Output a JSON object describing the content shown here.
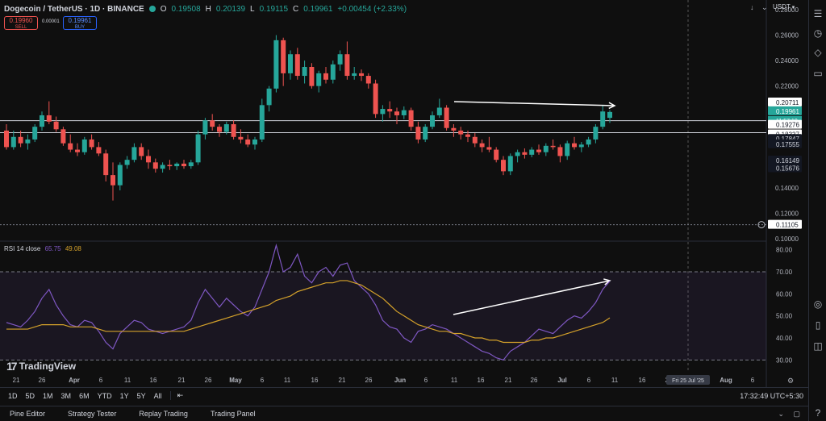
{
  "header": {
    "symbol": "Dogecoin / TetherUS · 1D · BINANCE",
    "o_label": "O",
    "o": "0.19508",
    "h_label": "H",
    "h": "0.20139",
    "l_label": "L",
    "l": "0.19115",
    "c_label": "C",
    "c": "0.19961",
    "change": "+0.00454 (+2.33%)",
    "currency": "USDT"
  },
  "trade": {
    "sell_price": "0.19960",
    "sell_label": "SELL",
    "buy_price": "0.19961",
    "buy_label": "BUY",
    "spread": "0.00001"
  },
  "price_axis": {
    "ticks": [
      "0.28000",
      "0.26000",
      "0.24000",
      "0.22000",
      "0.14000",
      "0.12000",
      "0.10000"
    ],
    "tags": {
      "t1": "0.20711",
      "current": "0.19961",
      "countdown": "11:57:10",
      "t3": "0.19276",
      "t4": "0.18337",
      "t5": "0.17847",
      "t6": "0.17555",
      "t7": "0.16149",
      "t8": "0.15676",
      "low": "0.11105"
    }
  },
  "rsi": {
    "label": "RSI 14 close",
    "value1": "65.75",
    "value2": "49.08",
    "ticks": [
      "80.00",
      "70.00",
      "60.00",
      "50.00",
      "40.00",
      "30.00"
    ]
  },
  "time_axis": {
    "labels": [
      "21",
      "26",
      "Apr",
      "6",
      "11",
      "16",
      "21",
      "26",
      "May",
      "6",
      "11",
      "16",
      "21",
      "26",
      "Jun",
      "6",
      "11",
      "16",
      "21",
      "26",
      "Jul",
      "6",
      "11",
      "16",
      "21",
      "Aug",
      "6"
    ],
    "crosshair_date": "Fri 25 Jul '25"
  },
  "timeframes": [
    "1D",
    "5D",
    "1M",
    "3M",
    "6M",
    "YTD",
    "1Y",
    "5Y",
    "All"
  ],
  "clock": "17:32:49 UTC+5:30",
  "footer_tabs": [
    "Pine Editor",
    "Strategy Tester",
    "Replay Trading",
    "Trading Panel"
  ],
  "logo_text": "TradingView",
  "colors": {
    "up": "#26a69a",
    "down": "#ef5350",
    "rsi": "#7e57c2",
    "rsi_ma": "#d4a12a"
  },
  "chart_data": {
    "type": "candlestick",
    "symbol": "DOGEUSDT",
    "interval": "1D",
    "ylim": [
      0.1,
      0.28
    ],
    "candles": [
      [
        0.185,
        0.19,
        0.17,
        0.172
      ],
      [
        0.172,
        0.185,
        0.17,
        0.18
      ],
      [
        0.18,
        0.185,
        0.172,
        0.175
      ],
      [
        0.175,
        0.182,
        0.17,
        0.178
      ],
      [
        0.178,
        0.19,
        0.176,
        0.188
      ],
      [
        0.188,
        0.2,
        0.185,
        0.197
      ],
      [
        0.197,
        0.208,
        0.19,
        0.192
      ],
      [
        0.192,
        0.196,
        0.184,
        0.186
      ],
      [
        0.186,
        0.188,
        0.173,
        0.175
      ],
      [
        0.175,
        0.182,
        0.168,
        0.17
      ],
      [
        0.17,
        0.175,
        0.165,
        0.168
      ],
      [
        0.168,
        0.18,
        0.166,
        0.178
      ],
      [
        0.178,
        0.182,
        0.17,
        0.172
      ],
      [
        0.172,
        0.176,
        0.165,
        0.167
      ],
      [
        0.167,
        0.17,
        0.145,
        0.15
      ],
      [
        0.15,
        0.16,
        0.13,
        0.142
      ],
      [
        0.142,
        0.16,
        0.138,
        0.158
      ],
      [
        0.158,
        0.165,
        0.155,
        0.162
      ],
      [
        0.162,
        0.175,
        0.16,
        0.172
      ],
      [
        0.172,
        0.175,
        0.162,
        0.165
      ],
      [
        0.165,
        0.17,
        0.155,
        0.16
      ],
      [
        0.16,
        0.163,
        0.152,
        0.155
      ],
      [
        0.155,
        0.16,
        0.152,
        0.158
      ],
      [
        0.158,
        0.162,
        0.154,
        0.157
      ],
      [
        0.157,
        0.16,
        0.154,
        0.159
      ],
      [
        0.159,
        0.162,
        0.155,
        0.157
      ],
      [
        0.157,
        0.162,
        0.155,
        0.16
      ],
      [
        0.16,
        0.185,
        0.158,
        0.182
      ],
      [
        0.182,
        0.195,
        0.178,
        0.193
      ],
      [
        0.193,
        0.198,
        0.185,
        0.188
      ],
      [
        0.188,
        0.19,
        0.18,
        0.184
      ],
      [
        0.184,
        0.192,
        0.182,
        0.19
      ],
      [
        0.19,
        0.193,
        0.178,
        0.18
      ],
      [
        0.18,
        0.186,
        0.175,
        0.178
      ],
      [
        0.178,
        0.182,
        0.172,
        0.174
      ],
      [
        0.174,
        0.18,
        0.17,
        0.178
      ],
      [
        0.178,
        0.21,
        0.176,
        0.205
      ],
      [
        0.205,
        0.22,
        0.2,
        0.218
      ],
      [
        0.218,
        0.26,
        0.215,
        0.256
      ],
      [
        0.256,
        0.258,
        0.22,
        0.23
      ],
      [
        0.23,
        0.248,
        0.225,
        0.245
      ],
      [
        0.245,
        0.25,
        0.225,
        0.228
      ],
      [
        0.228,
        0.24,
        0.222,
        0.235
      ],
      [
        0.235,
        0.238,
        0.218,
        0.22
      ],
      [
        0.22,
        0.232,
        0.215,
        0.23
      ],
      [
        0.23,
        0.235,
        0.222,
        0.225
      ],
      [
        0.225,
        0.24,
        0.222,
        0.237
      ],
      [
        0.237,
        0.248,
        0.232,
        0.245
      ],
      [
        0.245,
        0.255,
        0.225,
        0.228
      ],
      [
        0.228,
        0.235,
        0.225,
        0.23
      ],
      [
        0.23,
        0.233,
        0.224,
        0.228
      ],
      [
        0.228,
        0.23,
        0.218,
        0.222
      ],
      [
        0.222,
        0.225,
        0.195,
        0.198
      ],
      [
        0.198,
        0.205,
        0.192,
        0.202
      ],
      [
        0.202,
        0.208,
        0.195,
        0.2
      ],
      [
        0.2,
        0.203,
        0.19,
        0.197
      ],
      [
        0.197,
        0.204,
        0.194,
        0.201
      ],
      [
        0.201,
        0.203,
        0.185,
        0.188
      ],
      [
        0.188,
        0.192,
        0.175,
        0.178
      ],
      [
        0.178,
        0.19,
        0.176,
        0.188
      ],
      [
        0.188,
        0.2,
        0.186,
        0.197
      ],
      [
        0.197,
        0.21,
        0.195,
        0.203
      ],
      [
        0.203,
        0.205,
        0.185,
        0.187
      ],
      [
        0.187,
        0.19,
        0.18,
        0.185
      ],
      [
        0.185,
        0.188,
        0.178,
        0.182
      ],
      [
        0.182,
        0.185,
        0.176,
        0.18
      ],
      [
        0.18,
        0.183,
        0.172,
        0.175
      ],
      [
        0.175,
        0.178,
        0.168,
        0.172
      ],
      [
        0.172,
        0.18,
        0.168,
        0.17
      ],
      [
        0.17,
        0.172,
        0.16,
        0.162
      ],
      [
        0.162,
        0.165,
        0.15,
        0.153
      ],
      [
        0.153,
        0.167,
        0.15,
        0.165
      ],
      [
        0.165,
        0.17,
        0.16,
        0.168
      ],
      [
        0.168,
        0.171,
        0.163,
        0.166
      ],
      [
        0.166,
        0.172,
        0.164,
        0.17
      ],
      [
        0.17,
        0.174,
        0.166,
        0.168
      ],
      [
        0.168,
        0.175,
        0.165,
        0.173
      ],
      [
        0.173,
        0.178,
        0.17,
        0.172
      ],
      [
        0.172,
        0.174,
        0.16,
        0.165
      ],
      [
        0.165,
        0.177,
        0.162,
        0.175
      ],
      [
        0.175,
        0.18,
        0.17,
        0.172
      ],
      [
        0.172,
        0.176,
        0.168,
        0.174
      ],
      [
        0.174,
        0.18,
        0.172,
        0.178
      ],
      [
        0.178,
        0.19,
        0.175,
        0.188
      ],
      [
        0.188,
        0.205,
        0.186,
        0.2
      ],
      [
        0.195,
        0.201,
        0.191,
        0.1996
      ]
    ],
    "horizontal_levels": [
      0.20711,
      0.19276,
      0.18337,
      0.11105
    ],
    "rsi_series": [
      47,
      46,
      45,
      48,
      52,
      58,
      62,
      55,
      50,
      46,
      45,
      48,
      47,
      43,
      38,
      35,
      42,
      45,
      48,
      47,
      44,
      43,
      42,
      43,
      44,
      45,
      48,
      56,
      62,
      58,
      54,
      58,
      55,
      52,
      50,
      54,
      62,
      70,
      82,
      70,
      72,
      78,
      68,
      65,
      70,
      72,
      68,
      73,
      74,
      66,
      63,
      60,
      55,
      48,
      45,
      44,
      40,
      38,
      43,
      44,
      46,
      45,
      44,
      42,
      40,
      38,
      36,
      34,
      33,
      31,
      30,
      34,
      36,
      38,
      41,
      44,
      43,
      42,
      45,
      48,
      50,
      49,
      52,
      56,
      62,
      65.75
    ],
    "rsi_ma_series": [
      44,
      44,
      44,
      44,
      45,
      46,
      46,
      46,
      46,
      45,
      45,
      45,
      45,
      44,
      43,
      43,
      43,
      43,
      43,
      43,
      43,
      43,
      43,
      43,
      43,
      43,
      44,
      45,
      46,
      47,
      48,
      49,
      50,
      51,
      52,
      53,
      54,
      55,
      57,
      58,
      59,
      61,
      62,
      63,
      64,
      65,
      65,
      66,
      66,
      65,
      64,
      62,
      60,
      58,
      55,
      52,
      50,
      48,
      46,
      45,
      44,
      43,
      43,
      42,
      42,
      41,
      40,
      40,
      39,
      39,
      38,
      38,
      38,
      38,
      39,
      39,
      40,
      40,
      41,
      42,
      43,
      44,
      45,
      46,
      47,
      49.08
    ],
    "rsi_ylim": [
      25,
      85
    ],
    "rsi_bands": [
      70,
      30
    ]
  }
}
